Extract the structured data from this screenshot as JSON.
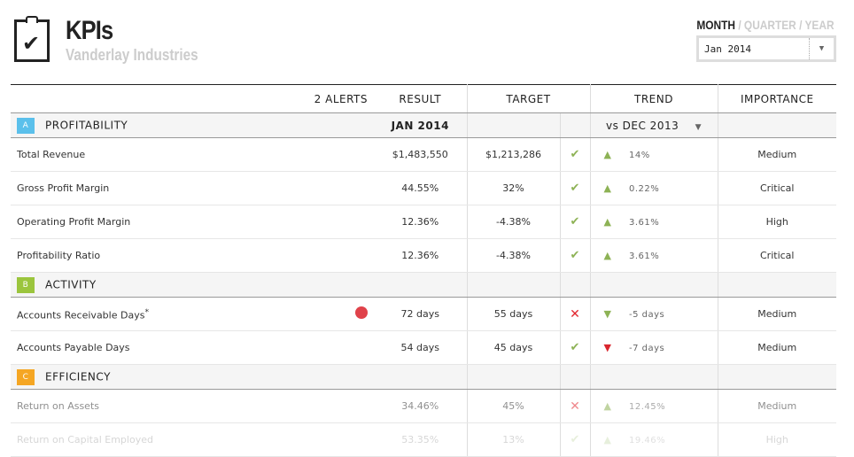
{
  "header": {
    "title": "KPIs",
    "subtitle": "Vanderlay Industries",
    "period_options": [
      "MONTH",
      "QUARTER",
      "YEAR"
    ],
    "selected_period": "MONTH",
    "date_select": "Jan 2014"
  },
  "columns": {
    "alerts": "2 ALERTS",
    "result": "RESULT",
    "target": "TARGET",
    "trend": "TREND",
    "importance": "IMPORTANCE"
  },
  "colors": {
    "A": "#5bc0eb",
    "B": "#9bc53d",
    "C": "#f5a623",
    "ok": "#8db255",
    "bad": "#e2262e"
  },
  "sections": [
    {
      "badge": "A",
      "name": "PROFITABILITY",
      "period": "JAN  2014",
      "compare": "vs DEC 2013",
      "rows": [
        {
          "name": "Total Revenue",
          "result": "$1,483,550",
          "target": "$1,213,286",
          "status": "ok",
          "trend": "up",
          "change": "14%",
          "importance": "Medium"
        },
        {
          "name": "Gross Profit Margin",
          "result": "44.55%",
          "target": "32%",
          "status": "ok",
          "trend": "up",
          "change": "0.22%",
          "importance": "Critical"
        },
        {
          "name": "Operating Profit Margin",
          "result": "12.36%",
          "target": "-4.38%",
          "status": "ok",
          "trend": "up",
          "change": "3.61%",
          "importance": "High"
        },
        {
          "name": "Profitability Ratio",
          "result": "12.36%",
          "target": "-4.38%",
          "status": "ok",
          "trend": "up",
          "change": "3.61%",
          "importance": "Critical"
        }
      ]
    },
    {
      "badge": "B",
      "name": "ACTIVITY",
      "rows": [
        {
          "name": "Accounts Receivable Days",
          "note": "*",
          "alert": true,
          "result": "72 days",
          "target": "55 days",
          "status": "bad",
          "trend": "down-good",
          "change": "-5 days",
          "importance": "Medium"
        },
        {
          "name": "Accounts Payable Days",
          "result": "54 days",
          "target": "45 days",
          "status": "ok",
          "trend": "down-bad",
          "change": "-7 days",
          "importance": "Medium"
        }
      ]
    },
    {
      "badge": "C",
      "name": "EFFICIENCY",
      "rows": [
        {
          "name": "Return on Assets",
          "result": "34.46%",
          "target": "45%",
          "status": "bad",
          "trend": "up",
          "change": "12.45%",
          "importance": "Medium"
        },
        {
          "name": "Return on Capital Employed",
          "result": "53.35%",
          "target": "13%",
          "status": "ok",
          "trend": "up",
          "change": "19.46%",
          "importance": "High"
        }
      ]
    }
  ]
}
